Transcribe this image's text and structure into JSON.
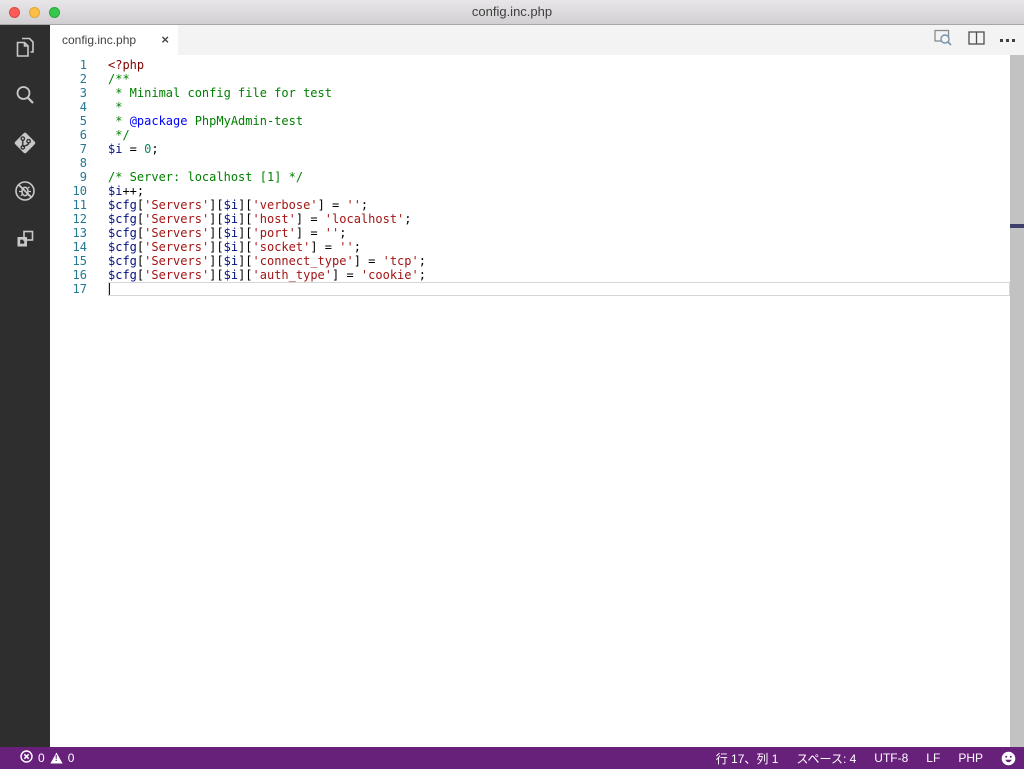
{
  "window": {
    "title": "config.inc.php"
  },
  "titlebar": {
    "buttons": [
      {
        "name": "close"
      },
      {
        "name": "minimize"
      },
      {
        "name": "zoom"
      }
    ]
  },
  "tab_bar": {
    "active_tab": {
      "label": "config.inc.php",
      "close_glyph": "×"
    },
    "actions": [
      {
        "name": "open-preview"
      },
      {
        "name": "split-editor"
      },
      {
        "name": "more-actions"
      }
    ]
  },
  "activity_bar": {
    "background": "#2e2e2e",
    "items": [
      {
        "name": "explorer"
      },
      {
        "name": "search"
      },
      {
        "name": "source-control"
      },
      {
        "name": "debug"
      },
      {
        "name": "extensions"
      }
    ]
  },
  "editor": {
    "language": "php",
    "cursor": {
      "line": 17,
      "column": 1
    },
    "colors": {
      "tag": "#800000",
      "comment": "#008000",
      "docTag": "#0000ff",
      "var": "#001080",
      "num": "#09885a",
      "str": "#a31515",
      "plain": "#000000",
      "line_number": "#237893"
    },
    "lines": [
      [
        {
          "t": "<?php",
          "c": "tag"
        }
      ],
      [
        {
          "t": "/**",
          "c": "comment"
        }
      ],
      [
        {
          "t": " * Minimal config file for test",
          "c": "comment"
        }
      ],
      [
        {
          "t": " *",
          "c": "comment"
        }
      ],
      [
        {
          "t": " * ",
          "c": "comment"
        },
        {
          "t": "@package",
          "c": "docTag"
        },
        {
          "t": " PhpMyAdmin-test",
          "c": "comment"
        }
      ],
      [
        {
          "t": " */",
          "c": "comment"
        }
      ],
      [
        {
          "t": "$i",
          "c": "var"
        },
        {
          "t": " = ",
          "c": "plain"
        },
        {
          "t": "0",
          "c": "num"
        },
        {
          "t": ";",
          "c": "plain"
        }
      ],
      [],
      [
        {
          "t": "/* Server: localhost [1] */",
          "c": "comment"
        }
      ],
      [
        {
          "t": "$i",
          "c": "var"
        },
        {
          "t": "++;",
          "c": "plain"
        }
      ],
      [
        {
          "t": "$cfg",
          "c": "var"
        },
        {
          "t": "[",
          "c": "plain"
        },
        {
          "t": "'Servers'",
          "c": "str"
        },
        {
          "t": "][",
          "c": "plain"
        },
        {
          "t": "$i",
          "c": "var"
        },
        {
          "t": "][",
          "c": "plain"
        },
        {
          "t": "'verbose'",
          "c": "str"
        },
        {
          "t": "] = ",
          "c": "plain"
        },
        {
          "t": "''",
          "c": "str"
        },
        {
          "t": ";",
          "c": "plain"
        }
      ],
      [
        {
          "t": "$cfg",
          "c": "var"
        },
        {
          "t": "[",
          "c": "plain"
        },
        {
          "t": "'Servers'",
          "c": "str"
        },
        {
          "t": "][",
          "c": "plain"
        },
        {
          "t": "$i",
          "c": "var"
        },
        {
          "t": "][",
          "c": "plain"
        },
        {
          "t": "'host'",
          "c": "str"
        },
        {
          "t": "] = ",
          "c": "plain"
        },
        {
          "t": "'localhost'",
          "c": "str"
        },
        {
          "t": ";",
          "c": "plain"
        }
      ],
      [
        {
          "t": "$cfg",
          "c": "var"
        },
        {
          "t": "[",
          "c": "plain"
        },
        {
          "t": "'Servers'",
          "c": "str"
        },
        {
          "t": "][",
          "c": "plain"
        },
        {
          "t": "$i",
          "c": "var"
        },
        {
          "t": "][",
          "c": "plain"
        },
        {
          "t": "'port'",
          "c": "str"
        },
        {
          "t": "] = ",
          "c": "plain"
        },
        {
          "t": "''",
          "c": "str"
        },
        {
          "t": ";",
          "c": "plain"
        }
      ],
      [
        {
          "t": "$cfg",
          "c": "var"
        },
        {
          "t": "[",
          "c": "plain"
        },
        {
          "t": "'Servers'",
          "c": "str"
        },
        {
          "t": "][",
          "c": "plain"
        },
        {
          "t": "$i",
          "c": "var"
        },
        {
          "t": "][",
          "c": "plain"
        },
        {
          "t": "'socket'",
          "c": "str"
        },
        {
          "t": "] = ",
          "c": "plain"
        },
        {
          "t": "''",
          "c": "str"
        },
        {
          "t": ";",
          "c": "plain"
        }
      ],
      [
        {
          "t": "$cfg",
          "c": "var"
        },
        {
          "t": "[",
          "c": "plain"
        },
        {
          "t": "'Servers'",
          "c": "str"
        },
        {
          "t": "][",
          "c": "plain"
        },
        {
          "t": "$i",
          "c": "var"
        },
        {
          "t": "][",
          "c": "plain"
        },
        {
          "t": "'connect_type'",
          "c": "str"
        },
        {
          "t": "] = ",
          "c": "plain"
        },
        {
          "t": "'tcp'",
          "c": "str"
        },
        {
          "t": ";",
          "c": "plain"
        }
      ],
      [
        {
          "t": "$cfg",
          "c": "var"
        },
        {
          "t": "[",
          "c": "plain"
        },
        {
          "t": "'Servers'",
          "c": "str"
        },
        {
          "t": "][",
          "c": "plain"
        },
        {
          "t": "$i",
          "c": "var"
        },
        {
          "t": "][",
          "c": "plain"
        },
        {
          "t": "'auth_type'",
          "c": "str"
        },
        {
          "t": "] = ",
          "c": "plain"
        },
        {
          "t": "'cookie'",
          "c": "str"
        },
        {
          "t": ";",
          "c": "plain"
        }
      ],
      []
    ]
  },
  "scrollbar": {
    "marker_color": "#3e3e6e"
  },
  "status_bar": {
    "background": "#68217a",
    "errors": "0",
    "warnings": "0",
    "right": [
      {
        "name": "line-col-indicator",
        "label": "行 17、列 1"
      },
      {
        "name": "indent-indicator",
        "label": "スペース: 4"
      },
      {
        "name": "encoding-indicator",
        "label": "UTF-8"
      },
      {
        "name": "eol-indicator",
        "label": "LF"
      },
      {
        "name": "language-indicator",
        "label": "PHP"
      }
    ]
  }
}
